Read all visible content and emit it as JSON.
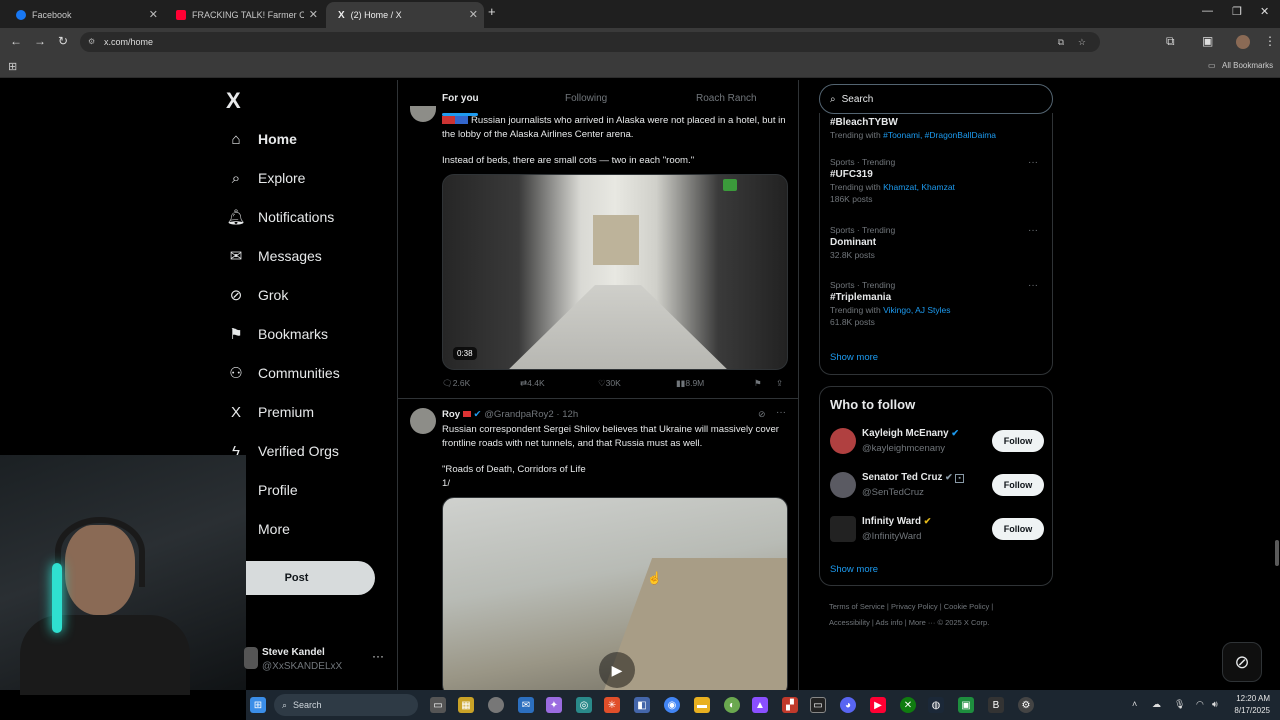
{
  "browser": {
    "tabs": [
      {
        "title": "Facebook",
        "color": "#1877f2"
      },
      {
        "title": "FRACKING TALK! Farmer Challe",
        "color": "#ff0033"
      },
      {
        "title": "(2) Home / X",
        "color": "#ffffff"
      }
    ],
    "new_tab": "+",
    "url": "x.com/home",
    "bookmarks_label": "All Bookmarks"
  },
  "sidebar": {
    "logo": "X",
    "items": [
      {
        "label": "Home",
        "icon": "⌂"
      },
      {
        "label": "Explore",
        "icon": "⌕"
      },
      {
        "label": "Notifications",
        "icon": "🔔︎"
      },
      {
        "label": "Messages",
        "icon": "✉"
      },
      {
        "label": "Grok",
        "icon": "⊘"
      },
      {
        "label": "Bookmarks",
        "icon": "⚑"
      },
      {
        "label": "Communities",
        "icon": "⚇"
      },
      {
        "label": "Premium",
        "icon": "X"
      },
      {
        "label": "Verified Orgs",
        "icon": "ϟ"
      },
      {
        "label": "Profile",
        "icon": "♙"
      },
      {
        "label": "More",
        "icon": "⊙"
      }
    ],
    "post_label": "Post",
    "account": {
      "name": "Steve Kandel",
      "handle": "@XxSKANDELxX",
      "more": "···"
    }
  },
  "feed": {
    "tabs": [
      "For you",
      "Following",
      "Roach Ranch"
    ],
    "tweet1": {
      "line1": "Russian journalists who arrived in Alaska were not placed in a hotel, but in the lobby of the Alaska Airlines Center arena.",
      "line2": "Instead of beds, there are small cots — two in each \"room.\"",
      "duration": "0:38",
      "replies": "2.6K",
      "reposts": "4.4K",
      "likes": "30K",
      "views": "8.9M"
    },
    "tweet2": {
      "name": "Roy",
      "handle": "@GrandpaRoy2",
      "time": "· 12h",
      "text": "Russian correspondent Sergei Shilov believes that Ukraine will massively cover frontline roads with net tunnels, and that Russia must as well.",
      "quote1": "\"Roads of Death, Corridors of Life",
      "quote2": "1/"
    }
  },
  "right": {
    "search_placeholder": "Search",
    "trends": [
      {
        "category": "",
        "title": "#BleachTYBW",
        "with_prefix": "Trending with",
        "with": "#Toonami, #DragonBallDaima",
        "posts": ""
      },
      {
        "category": "Sports · Trending",
        "title": "#UFC319",
        "with_prefix": "Trending with",
        "with": "Khamzat, Khamzat",
        "posts": "186K posts"
      },
      {
        "category": "Sports · Trending",
        "title": "Dominant",
        "with_prefix": "",
        "with": "",
        "posts": "32.8K posts"
      },
      {
        "category": "Sports · Trending",
        "title": "#Triplemania",
        "with_prefix": "Trending with",
        "with": "Vikingo, AJ Styles",
        "posts": "61.8K posts"
      }
    ],
    "show_more": "Show more",
    "who_to_follow": {
      "title": "Who to follow",
      "people": [
        {
          "name": "Kayleigh McEnany",
          "handle": "@kayleighmcenany",
          "follow": "Follow"
        },
        {
          "name": "Senator Ted Cruz",
          "handle": "@SenTedCruz",
          "follow": "Follow"
        },
        {
          "name": "Infinity Ward",
          "handle": "@InfinityWard",
          "follow": "Follow"
        }
      ],
      "show_more": "Show more"
    },
    "footer1": "Terms of Service  |  Privacy Policy  |  Cookie Policy  |",
    "footer2": "Accessibility  |  Ads info  |  More ···  © 2025 X Corp."
  },
  "taskbar": {
    "search": "Search",
    "time": "12:20 AM",
    "date": "8/17/2025"
  }
}
